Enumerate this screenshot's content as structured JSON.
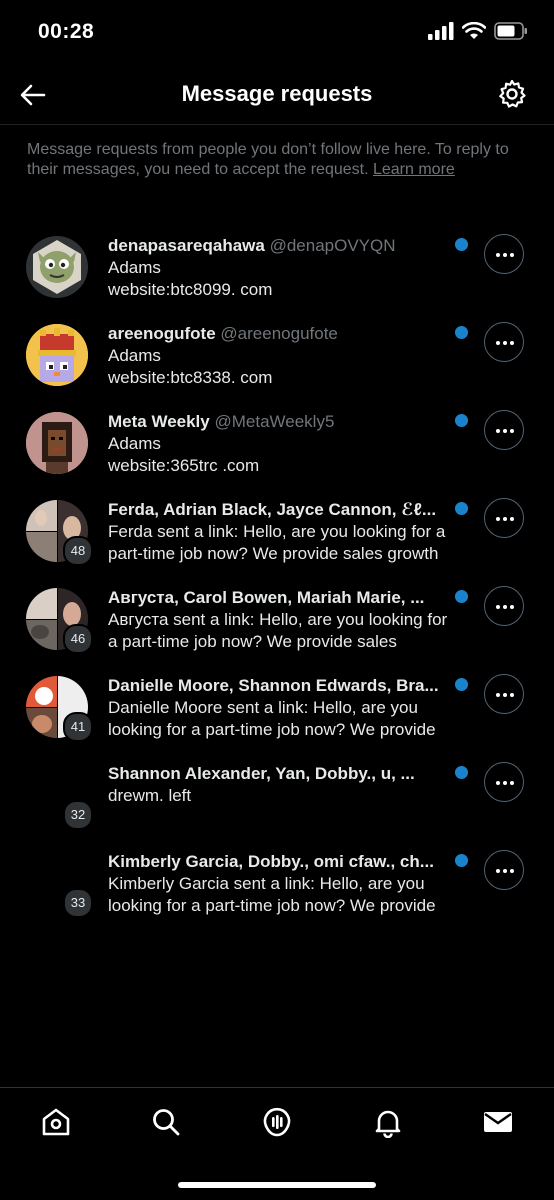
{
  "status": {
    "time": "00:28"
  },
  "header": {
    "title": "Message requests"
  },
  "info": {
    "text": "Message requests from people you don’t follow live here. To reply to their messages, you need to accept the request. ",
    "learn_more": "Learn more"
  },
  "rows": [
    {
      "name": "denapasareqahawa",
      "handle": "@denapOVYQN",
      "line2": "Adams",
      "line3": "website:btc8099. com"
    },
    {
      "name": "areenogufote",
      "handle": "@areenogufote",
      "line2": "Adams",
      "line3": "website:btc8338. com"
    },
    {
      "name": "Meta Weekly",
      "handle": "@MetaWeekly5",
      "line2": "Adams",
      "line3": "website:365trc .com"
    },
    {
      "name": "Ferda, Adrian Black, Jayce Cannon, ℰℓ...",
      "handle": "",
      "line2": "Ferda sent a link: Hello, are you looking for a",
      "line3": "part-time job now? We provide sales growth",
      "count": "48"
    },
    {
      "name": "Августа, Carol Bowen, Mariah Marie, ...",
      "handle": "",
      "line2": "Августа sent a link: Hello, are you looking for",
      "line3": "a part-time job now? We provide sales",
      "count": "46"
    },
    {
      "name": "Danielle Moore, Shannon Edwards, Bra...",
      "handle": "",
      "line2": "Danielle Moore sent a link: Hello, are you",
      "line3": "looking for a part-time job now? We provide",
      "count": "41"
    },
    {
      "name": "Shannon Alexander, Yan, Dobby., u, ...",
      "handle": "",
      "line2": "drewm. left",
      "line3": "",
      "count": "32"
    },
    {
      "name": "Kimberly Garcia, Dobby., omi cfaw., ch...",
      "handle": "",
      "line2": "Kimberly Garcia sent a link: Hello, are you",
      "line3": "looking for a part-time job now? We provide",
      "count": "33"
    }
  ],
  "tabs": [
    "home-icon",
    "search-icon",
    "spaces-icon",
    "notifications-icon",
    "messages-icon"
  ],
  "colors": {
    "accent": "#1d9bf0",
    "background": "#000000",
    "muted": "#71767b"
  }
}
